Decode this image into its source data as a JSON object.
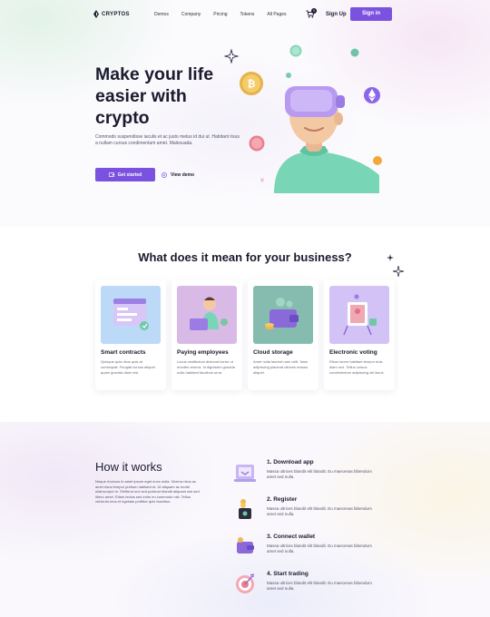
{
  "nav": {
    "logo_text": "CRYPTOS",
    "links": [
      "Demos",
      "Company",
      "Pricing",
      "Tokens",
      "All Pages"
    ],
    "cart_count": "0",
    "signup_label": "Sign Up",
    "signin_label": "Sign in"
  },
  "hero": {
    "title": "Make your life easier with crypto",
    "subtitle": "Commodo suspendisse iaculis et ac justo metus id dui ut. Habitant risus a nullam cursus condimentum amet. Malesuada.",
    "primary_button": "Get started",
    "secondary_button": "View demo"
  },
  "business": {
    "title": "What does it mean for your business?",
    "cards": [
      {
        "title": "Smart contracts",
        "text": "Quisque quis risus quis at consequat. Feugiat cursus aliquet quam gravida diam nisl.",
        "color": "#bcd9f8"
      },
      {
        "title": "Paying employees",
        "text": "Lacus vestibulum dictumst tortor ut montes viverra. Id dignissim gravida nulla habitant faucibus urna.",
        "color": "#d9b9e6"
      },
      {
        "title": "Cloud storage",
        "text": "Amet nulla laoreet nam velit. Nam adipiscing placerat ultrices massa aliquet.",
        "color": "#86bcb0"
      },
      {
        "title": "Electronic voting",
        "text": "Risus lorem habitant tempor duis diam orci. Tellus cursus condimentum adipiscing vel lacus.",
        "color": "#d2c2f6"
      }
    ]
  },
  "how": {
    "title": "How it works",
    "text": "Neque rhoncus in amet ipsum eget nunc nulla. Viverra risus ac amet risus tempor pretium habitant et. Ut aliquam ac morbi ullamcorper in. Eleifend orci sed pulvinar blandit aliquam nisl sed libero amet. Etiam lectus sed enim eu commodo nisl. Tellus vehicula eros et egestas porttitor quis faucibus.",
    "steps": [
      {
        "title": "1. Download app",
        "text": "Massa ultrices blandit elit blandit. Eu maecenas bibendum amet sed nulla."
      },
      {
        "title": "2. Register",
        "text": "Massa ultrices blandit elit blandit. Eu maecenas bibendum amet sed nulla."
      },
      {
        "title": "3. Connect wallet",
        "text": "Massa ultrices blandit elit blandit. Eu maecenas bibendum amet sed nulla."
      },
      {
        "title": "4. Start trading",
        "text": "Massa ultrices blandit elit blandit. Eu maecenas bibendum amet sed nulla."
      }
    ]
  },
  "colors": {
    "accent": "#7b52e0",
    "text": "#1c1b2e",
    "muted": "#6b6a7e"
  }
}
